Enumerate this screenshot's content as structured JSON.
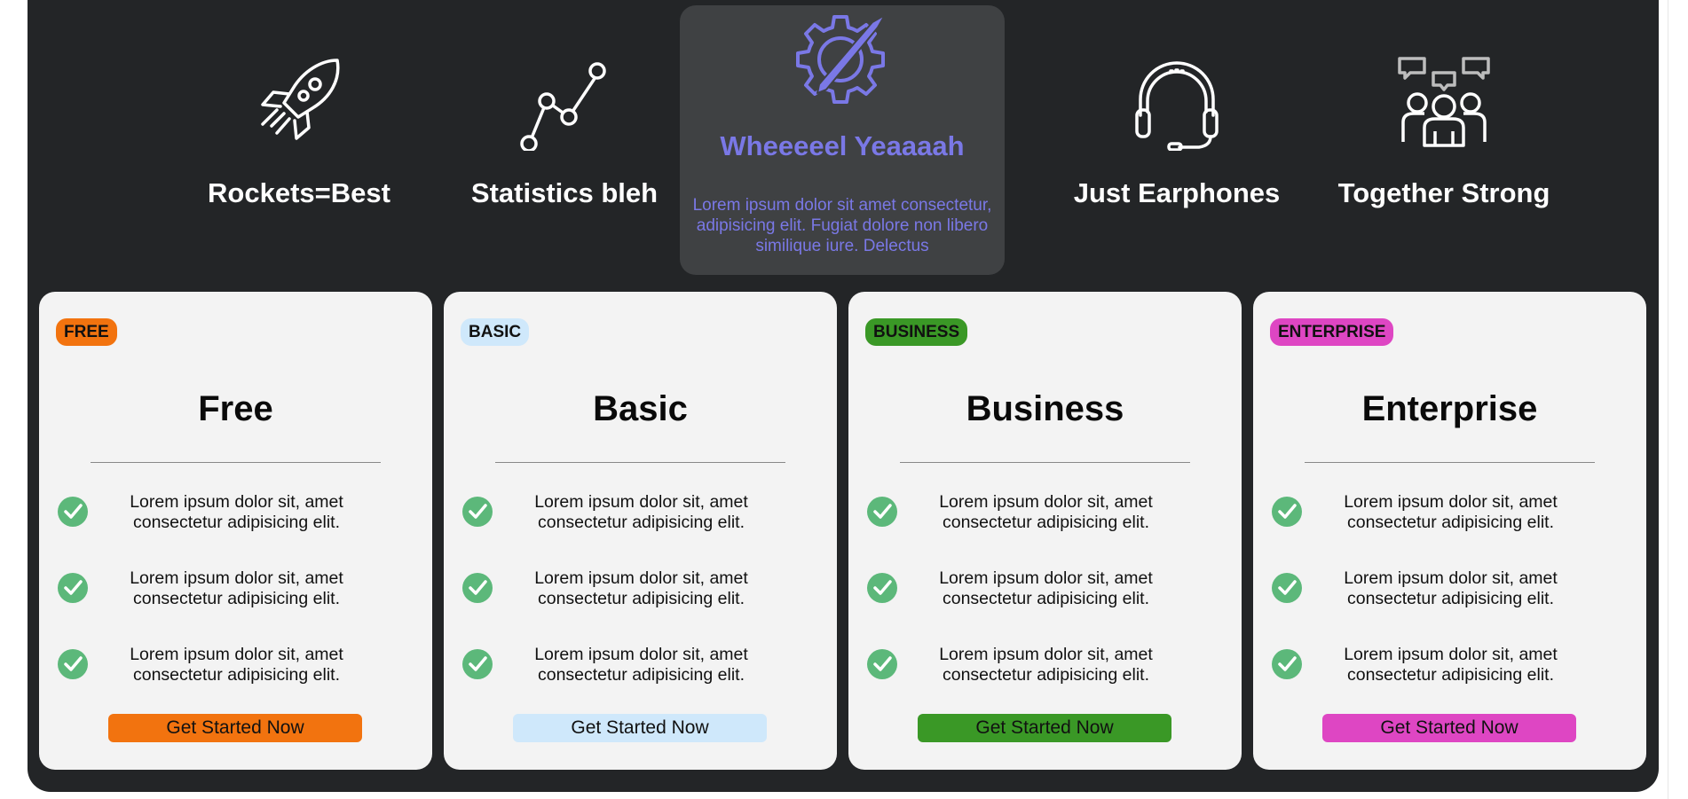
{
  "features": [
    {
      "title": "Rockets=Best",
      "icon": "rocket-icon"
    },
    {
      "title": "Statistics bleh",
      "icon": "statistics-icon"
    },
    {
      "title": "Wheeeeel Yeaaaah",
      "icon": "gear-pencil-icon",
      "description": "Lorem ipsum dolor sit amet consectetur, adipisicing elit. Fugiat dolore non libero similique iure. Delectus"
    },
    {
      "title": "Just Earphones",
      "icon": "headphones-icon"
    },
    {
      "title": "Together Strong",
      "icon": "team-icon"
    }
  ],
  "plans": [
    {
      "badge": "FREE",
      "title": "Free",
      "color": "#f2730f",
      "features": [
        "Lorem ipsum dolor sit, amet consectetur adipisicing elit.",
        "Lorem ipsum dolor sit, amet consectetur adipisicing elit.",
        "Lorem ipsum dolor sit, amet consectetur adipisicing elit."
      ],
      "cta": "Get Started Now"
    },
    {
      "badge": "BASIC",
      "title": "Basic",
      "color": "#cfe8fb",
      "features": [
        "Lorem ipsum dolor sit, amet consectetur adipisicing elit.",
        "Lorem ipsum dolor sit, amet consectetur adipisicing elit.",
        "Lorem ipsum dolor sit, amet consectetur adipisicing elit."
      ],
      "cta": "Get Started Now"
    },
    {
      "badge": "BUSINESS",
      "title": "Business",
      "color": "#3a9826",
      "features": [
        "Lorem ipsum dolor sit, amet consectetur adipisicing elit.",
        "Lorem ipsum dolor sit, amet consectetur adipisicing elit.",
        "Lorem ipsum dolor sit, amet consectetur adipisicing elit."
      ],
      "cta": "Get Started Now"
    },
    {
      "badge": "ENTERPRISE",
      "title": "Enterprise",
      "color": "#de46c3",
      "features": [
        "Lorem ipsum dolor sit, amet consectetur adipisicing elit.",
        "Lorem ipsum dolor sit, amet consectetur adipisicing elit.",
        "Lorem ipsum dolor sit, amet consectetur adipisicing elit."
      ],
      "cta": "Get Started Now"
    }
  ],
  "colors": {
    "panel": "#232527",
    "accent": "#7a78e6",
    "check": "#5cb87a",
    "card": "#f3f3f3"
  }
}
